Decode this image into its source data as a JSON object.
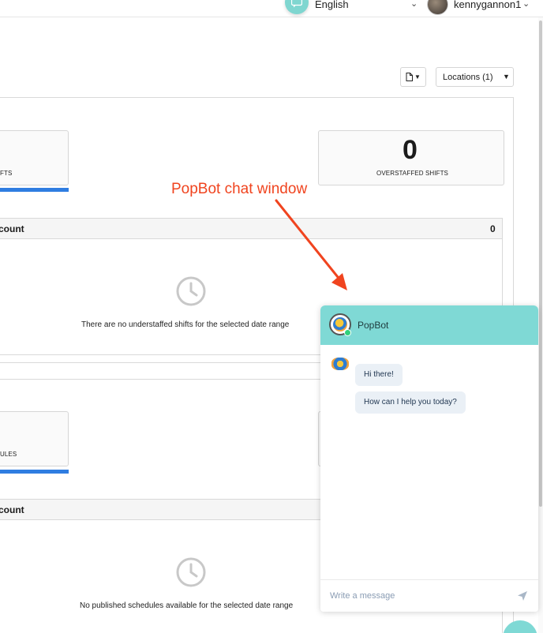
{
  "header": {
    "language": "English",
    "username": "kennygannon1",
    "icons": {
      "chat": "chat-bubble-icon",
      "caret": "chevron-down-icon"
    }
  },
  "toolbar": {
    "export_icon": "file-icon",
    "locations_label": "Locations (1)"
  },
  "top_panel": {
    "left_stat_label": "FTS",
    "right_stat_value": "0",
    "right_stat_label": "OVERSTAFFED SHIFTS",
    "section_title": "count",
    "section_count": "0",
    "empty_message": "There are no understaffed shifts for the selected date range"
  },
  "bottom_panel": {
    "left_stat_label": "ULES",
    "section_title": "count",
    "empty_message": "No published schedules available for the selected date range"
  },
  "annotation": {
    "text": "PopBot chat window",
    "color": "#f0441f"
  },
  "chat": {
    "bot_name": "PopBot",
    "messages": [
      "Hi there!",
      "How can I help you today?"
    ],
    "input_placeholder": "Write a message",
    "header_color": "#7fd9d5"
  },
  "colors": {
    "accent_blue": "#2f7de1",
    "teal": "#7fd9d5"
  }
}
